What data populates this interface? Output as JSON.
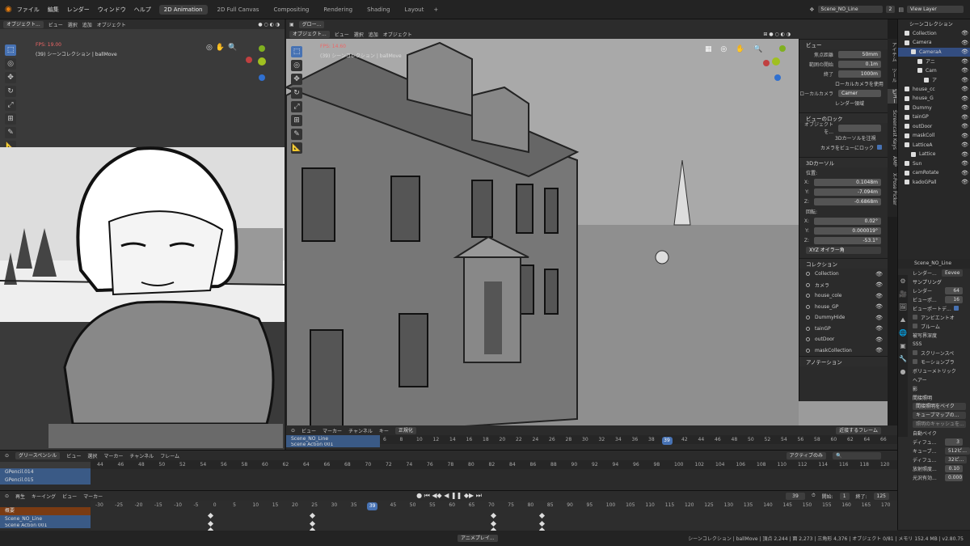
{
  "topbar": {
    "menus": [
      "ファイル",
      "編集",
      "レンダー",
      "ウィンドウ",
      "ヘルプ"
    ],
    "workspaces": [
      "2D Animation",
      "2D Full Canvas",
      "Compositing",
      "Rendering",
      "Shading",
      "Layout"
    ],
    "active_workspace": "2D Animation",
    "scene_name": "Scene_NO_Line",
    "scene_index": "2",
    "view_layer": "View Layer"
  },
  "left_viewport": {
    "mode": "オブジェクト...",
    "menus": [
      "ビュー",
      "選択",
      "追加",
      "オブジェクト"
    ],
    "fps": "FPS: 19.00",
    "info": "(39) シーンコレクション | ballMove"
  },
  "right_viewport": {
    "mode": "オブジェクト...",
    "menus": [
      "ビュー",
      "選択",
      "追加",
      "オブジェクト"
    ],
    "glow": "グロー...",
    "fps": "FPS: 14.60",
    "info": "(39) シーンコレクション | ballMove"
  },
  "npanel": {
    "tabs": [
      "アイテム",
      "ツール",
      "ビュー",
      "Screencast Keys",
      "AMP",
      "X-Pose Picker"
    ],
    "view_section": "ビュー",
    "focal_label": "焦点距離",
    "focal_value": "50mm",
    "clip_start_label": "範囲の開始",
    "clip_start_value": "0.1m",
    "clip_end_label": "終了",
    "clip_end_value": "1000m",
    "local_camera_use": "ローカルカメラを使用",
    "local_camera_label": "ローカルカメラ",
    "local_camera_value": "Camer",
    "render_region": "レンダー領域",
    "view_lock_section": "ビューのロック",
    "lock_object_label": "オブジェクトを...",
    "lock_3dcursor": "3Dカーソルを注視",
    "lock_camera": "カメラをビューにロック",
    "cursor_section": "3Dカーソル",
    "location_label": "位置:",
    "x_label": "X:",
    "y_label": "Y:",
    "z_label": "Z:",
    "loc_x": "0.1048m",
    "loc_y": "-7.094m",
    "loc_z": "-0.6868m",
    "rotation_label": "回転:",
    "rot_x": "0.02°",
    "rot_y": "0.000019°",
    "rot_z": "-53.1°",
    "rot_mode": "XYZ オイラー角",
    "collection_section": "コレクション",
    "collections": [
      "Collection",
      "カメラ",
      "house_cole",
      "house_GP",
      "DummyHide",
      "tainGP",
      "outDoor",
      "maskCollection"
    ],
    "annotation_section": "アノテーション"
  },
  "outliner": {
    "title": "シーンコレクション",
    "items": [
      "Collection",
      "Camera",
      "CameraA",
      "アニ",
      "Cam",
      "ア",
      "house_cc",
      "house_G",
      "Dummy",
      "tainGP",
      "outDoor",
      "maskColl",
      "LatticeA",
      "Lattice",
      "Sun",
      "camRotate",
      "kadoGPall"
    ]
  },
  "properties": {
    "scene": "Scene_NO_Line",
    "render_engine_label": "レンダー...",
    "render_engine": "Eevee",
    "sampling": "サンプリング",
    "render_label": "レンダー",
    "render_samples": "64",
    "viewport_label": "ビューポ...",
    "viewport_samples": "16",
    "viewport_denoise": "ビューポートデ...",
    "ambient_occlusion": "アンビエントオ",
    "bloom": "ブルーム",
    "dof": "被写界深度",
    "sss": "SSS",
    "ssr": "スクリーンスペ",
    "motion_blur": "モーションブラ",
    "volumetrics": "ボリューメトリック",
    "hair": "ヘアー",
    "shadows": "影",
    "indirect": "間接照明",
    "bake_indirect": "間接照明をベイク",
    "bake_cubemap": "キューブマップの...",
    "delete_cache": "照明のキャッシュを...",
    "auto_bake": "自動ベイク",
    "diffuse_label": "ディフュ...",
    "diffuse_bounces": "3",
    "cubemap_label": "キューブ...",
    "cubemap_size": "512ピ...",
    "diffuse2_label": "ディフュ...",
    "diffuse_size": "32ピ...",
    "clamp_label": "放射照度...",
    "clamp_value": "0.10",
    "filter_label": "光沢有効...",
    "filter_value": "0.000"
  },
  "dopesheet": {
    "editor": "正規化",
    "channel_menus": [
      "ビュー",
      "マーカー",
      "チャンネル",
      "キー"
    ],
    "snap": "近接するフレーム",
    "scene_row": "Scene_NO_Line",
    "action_row": "Scene Action 001",
    "frames": [
      "6",
      "8",
      "10",
      "12",
      "14",
      "16",
      "18",
      "20",
      "22",
      "24",
      "26",
      "28",
      "30",
      "32",
      "34",
      "36",
      "38",
      "39",
      "42",
      "44",
      "46",
      "48",
      "50",
      "52",
      "54",
      "56",
      "58",
      "60",
      "62",
      "64",
      "66"
    ]
  },
  "gp_editor": {
    "mode": "グリースペンシル",
    "menus": [
      "ビュー",
      "選択",
      "マーカー",
      "チャンネル",
      "フレーム"
    ],
    "active_only": "アクティブのみ",
    "channels": [
      "GPencil.014",
      "GPencil.015"
    ],
    "frames": [
      "44",
      "46",
      "48",
      "50",
      "52",
      "54",
      "56",
      "58",
      "60",
      "62",
      "64",
      "66",
      "68",
      "70",
      "72",
      "74",
      "76",
      "78",
      "80",
      "82",
      "84",
      "86",
      "88",
      "90",
      "92",
      "94",
      "96",
      "98",
      "100",
      "102",
      "104",
      "106",
      "108",
      "110",
      "112",
      "114",
      "116",
      "118",
      "120"
    ]
  },
  "timeline": {
    "playback": "再生",
    "keying": "キーイング",
    "menus": [
      "ビュー",
      "マーカー"
    ],
    "current_frame": "39",
    "start_label": "開始:",
    "start_frame": "1",
    "end_label": "終了:",
    "end_frame": "125",
    "summary": "概要",
    "scene_row": "Scene_NO_Line",
    "action_row": "Scene Action 001",
    "frames": [
      "-30",
      "-25",
      "-20",
      "-15",
      "-10",
      "-5",
      "0",
      "5",
      "10",
      "15",
      "20",
      "25",
      "30",
      "35",
      "39",
      "45",
      "50",
      "55",
      "60",
      "65",
      "70",
      "75",
      "80",
      "85",
      "90",
      "95",
      "100",
      "105",
      "110",
      "115",
      "120",
      "125",
      "130",
      "135",
      "140",
      "145",
      "150",
      "155",
      "160",
      "165",
      "170"
    ]
  },
  "statusbar": {
    "anim_play": "アニメプレイ...",
    "stats": "シーンコレクション | ballMove | 頂点 2,244 | 面 2,273 | 三角形 4,376 | オブジェクト 0/81 | メモリ 152.4 MB | v2.80.75"
  },
  "colors": {
    "accent": "#4772b3",
    "bg": "#1d1d1d",
    "panel": "#2b2b2b",
    "fps": "#e66666",
    "channel_blue": "#3a5a86",
    "summary_orange": "#7a3b13"
  }
}
